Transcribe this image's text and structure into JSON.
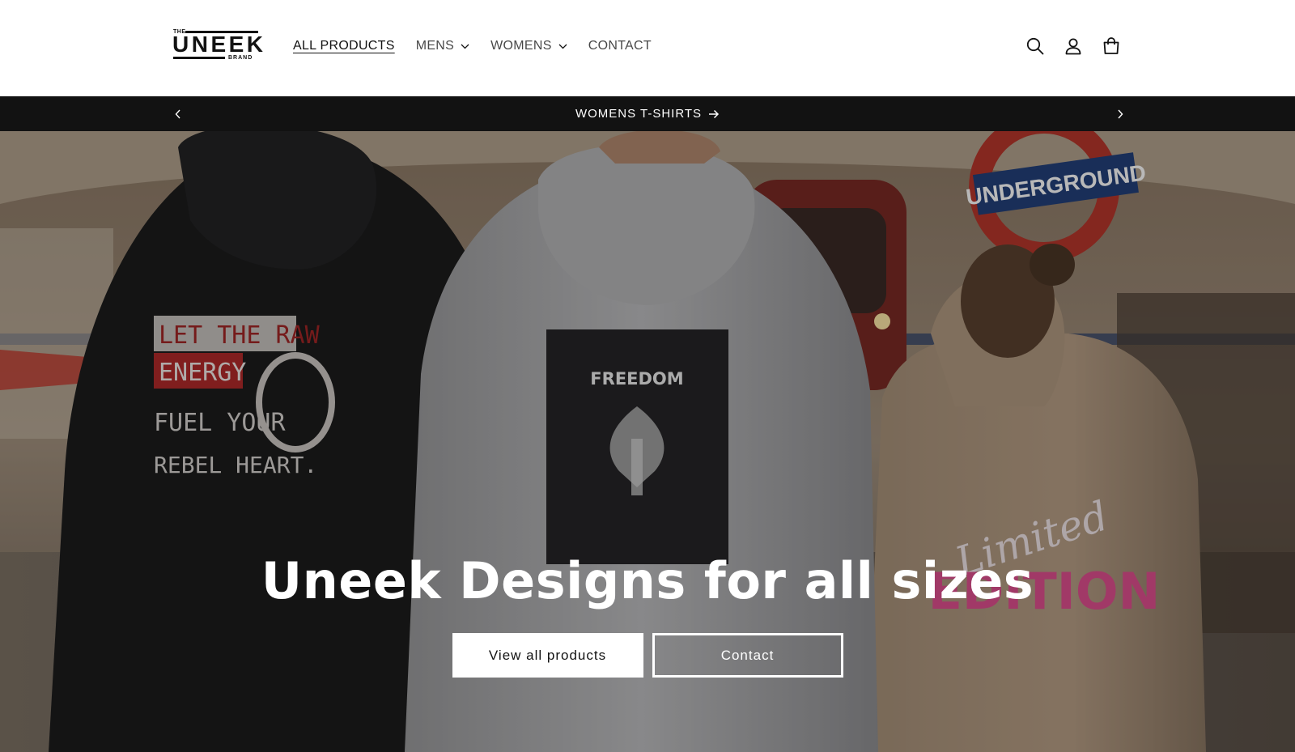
{
  "brand": {
    "logo_top": "THE",
    "logo_word": "UNEEK",
    "logo_bottom": "BRAND"
  },
  "nav": {
    "items": [
      {
        "label": "ALL PRODUCTS",
        "active": true,
        "dropdown": false
      },
      {
        "label": "MENS",
        "active": false,
        "dropdown": true
      },
      {
        "label": "WOMENS",
        "active": false,
        "dropdown": true
      },
      {
        "label": "CONTACT",
        "active": false,
        "dropdown": false
      }
    ]
  },
  "header_icons": [
    "search-icon",
    "account-icon",
    "cart-icon"
  ],
  "announcement": {
    "text": "WOMENS T-SHIRTS",
    "prev_icon": "chevron-left-icon",
    "next_icon": "chevron-right-icon"
  },
  "hero": {
    "title": "Uneek Designs for all sizes",
    "primary_button": "View all products",
    "secondary_button": "Contact",
    "image_text": {
      "sign": "UNDERGROUND",
      "hoodie_left_line1": "LET THE RAW",
      "hoodie_left_line2": "ENERGY",
      "hoodie_left_line3": "FUEL YOUR",
      "hoodie_left_line4": "REBEL HEART.",
      "hoodie_center": "FREEDOM",
      "hoodie_right_script": "Limited",
      "hoodie_right_block": "EDITION"
    }
  },
  "colors": {
    "text": "#121212",
    "announcement_bg": "#121212",
    "button_bg": "#ffffff",
    "edition_pink": "#e0508f"
  }
}
